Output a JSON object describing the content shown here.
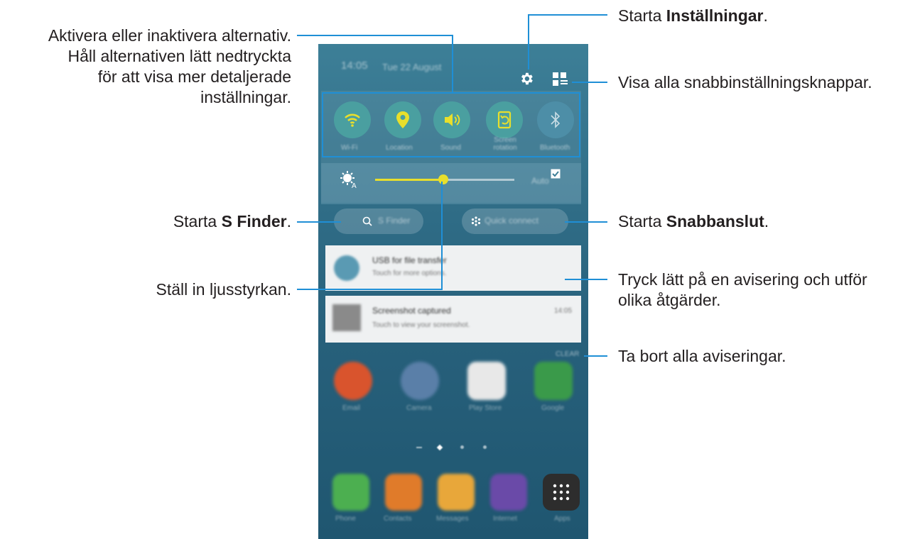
{
  "annotations": {
    "toggle": {
      "line1": "Aktivera eller inaktivera alternativ.",
      "line2": "Håll alternativen lätt nedtryckta",
      "line3": "för att visa mer detaljerade",
      "line4": "inställningar."
    },
    "settings": {
      "prefix": "Starta ",
      "bold": "Inställningar",
      "suffix": "."
    },
    "show_all": {
      "text": "Visa alla snabbinställningsknappar."
    },
    "s_finder": {
      "prefix": "Starta ",
      "bold": "S Finder",
      "suffix": "."
    },
    "quick_connect": {
      "prefix": "Starta ",
      "bold": "Snabbanslut",
      "suffix": "."
    },
    "brightness": {
      "text": "Ställ in ljusstyrkan."
    },
    "notification": {
      "line1": "Tryck lätt på en avisering och utför",
      "line2": "olika åtgärder."
    },
    "clear": {
      "text": "Ta bort alla aviseringar."
    }
  },
  "phone": {
    "status_time": "14:05",
    "status_date": "Tue 22 August",
    "quick_settings": [
      {
        "label": "Wi-Fi",
        "icon": "wifi-icon",
        "state": "on"
      },
      {
        "label": "Location",
        "icon": "location-icon",
        "state": "on"
      },
      {
        "label": "Sound",
        "icon": "sound-icon",
        "state": "on"
      },
      {
        "label": "Screen rotation",
        "icon": "rotation-icon",
        "state": "on"
      },
      {
        "label": "Bluetooth",
        "icon": "bluetooth-icon",
        "state": "off"
      }
    ],
    "brightness": {
      "level": 0.49,
      "auto_label": "Auto"
    },
    "s_finder_label": "S Finder",
    "quick_connect_label": "Quick connect",
    "notifications": [
      {
        "title": "USB for file transfer",
        "subtitle": "Touch for more options."
      },
      {
        "title": "Screenshot captured",
        "subtitle": "Touch to view your screenshot.",
        "time": "14:05"
      }
    ],
    "clear_label": "CLEAR",
    "apps": [
      {
        "label": "Email",
        "color": "#d9542d"
      },
      {
        "label": "Camera",
        "color": "#5a7fa8"
      },
      {
        "label": "Play Store",
        "color": "#e8e8e8"
      },
      {
        "label": "Google",
        "color": "#3a9a4a"
      }
    ],
    "dock": [
      {
        "label": "Phone",
        "color": "#4caf50"
      },
      {
        "label": "Contacts",
        "color": "#e07b2a"
      },
      {
        "label": "Messages",
        "color": "#e8a73a"
      },
      {
        "label": "Internet",
        "color": "#6a4aa8"
      },
      {
        "label": "Apps",
        "color": "#2d2d2d"
      }
    ]
  },
  "colors": {
    "accent_line": "#1f8fd6",
    "slider": "#e8df2c"
  }
}
